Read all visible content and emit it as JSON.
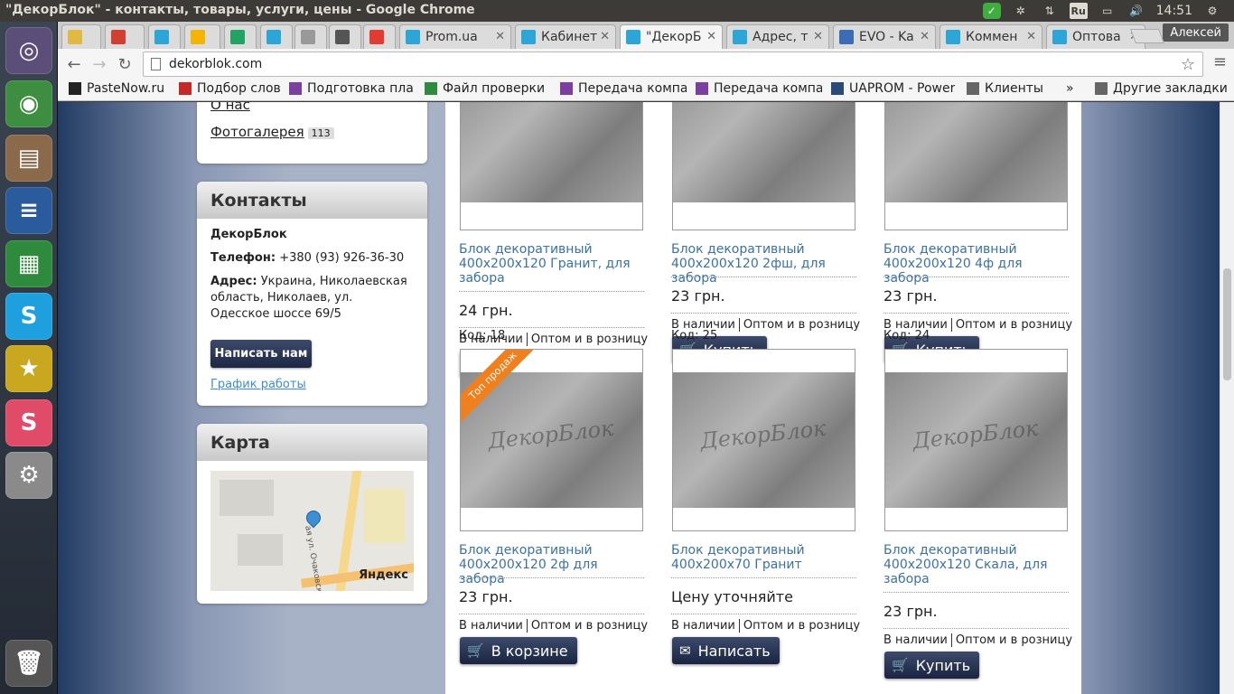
{
  "window": {
    "title": "\"ДекорБлок\" - контакты, товары, услуги, цены - Google Chrome"
  },
  "tray": {
    "lang": "Ru",
    "time": "14:51"
  },
  "launcher": [
    {
      "name": "ubuntu-dash",
      "glyph": "◎",
      "color": "#5b4f7a"
    },
    {
      "name": "chrome",
      "glyph": "◉",
      "color": "#3e8e41"
    },
    {
      "name": "files",
      "glyph": "▤",
      "color": "#8a6a4a"
    },
    {
      "name": "writer",
      "glyph": "≡",
      "color": "#2a5b9c"
    },
    {
      "name": "calc",
      "glyph": "▦",
      "color": "#2e8b3e"
    },
    {
      "name": "skype",
      "glyph": "S",
      "color": "#1ea0df"
    },
    {
      "name": "star-app",
      "glyph": "★",
      "color": "#c9a820"
    },
    {
      "name": "slack",
      "glyph": "S",
      "color": "#e04b67"
    },
    {
      "name": "settings",
      "glyph": "⚙",
      "color": "#8a8a8a"
    },
    {
      "name": "trash",
      "glyph": "🗑",
      "color": "#555"
    }
  ],
  "tabs": [
    {
      "label": "",
      "color": "#e0b940"
    },
    {
      "label": "",
      "color": "#d23f31"
    },
    {
      "label": "",
      "color": "#2aa6d8"
    },
    {
      "label": "",
      "color": "#f4b400"
    },
    {
      "label": "",
      "color": "#1fa463"
    },
    {
      "label": "",
      "color": "#2aa6d8"
    },
    {
      "label": "",
      "color": "#999"
    },
    {
      "label": "",
      "color": "#555"
    },
    {
      "label": "",
      "color": "#e33b2e"
    },
    {
      "label": "Prom.ua",
      "color": "#2aa6d8"
    },
    {
      "label": "Кабинет",
      "color": "#2aa6d8"
    },
    {
      "label": "\"ДекорБ",
      "color": "#2aa6d8"
    },
    {
      "label": "Адрес, т",
      "color": "#2aa6d8"
    },
    {
      "label": "EVO - Ka",
      "color": "#3a6db5"
    },
    {
      "label": "Коммен",
      "color": "#2aa6d8"
    },
    {
      "label": "Оптова",
      "color": "#2aa6d8"
    }
  ],
  "user": "Алексей",
  "url": "dekorblok.com",
  "bookmarks": [
    {
      "label": "PasteNow.ru",
      "color": "#222"
    },
    {
      "label": "Подбор слов",
      "color": "#c62828"
    },
    {
      "label": "Подготовка пла",
      "color": "#7b3fa0"
    },
    {
      "label": "Файл проверки",
      "color": "#2e8b3e"
    },
    {
      "label": "Передача компа",
      "color": "#7b3fa0"
    },
    {
      "label": "Передача компа",
      "color": "#7b3fa0"
    },
    {
      "label": "UAPROM - Power",
      "color": "#2b4a78"
    },
    {
      "label": "Клиенты",
      "color": "#666"
    }
  ],
  "bookmarks_more": "»",
  "bookmarks_other": "Другие закладки",
  "sidebar": {
    "about": "О нас",
    "gallery": "Фотогалерея",
    "gallery_count": "113",
    "contacts": {
      "title": "Контакты",
      "company": "ДекорБлок",
      "phone_label": "Телефон:",
      "phone": "+380 (93) 926-36-30",
      "address_label": "Адрес:",
      "address": "Украина, Николаевская область, Николаев, ул. Одесское шоссе 69/5",
      "write_btn": "Написать нам",
      "schedule": "График работы"
    },
    "map": {
      "title": "Карта",
      "street": "ая ул. Очаковская ул",
      "brand": "Яндекс"
    }
  },
  "products": [
    {
      "code": "",
      "name": "Блок декоративный 400х200х120 Гранит, для забора",
      "price": "24 грн.",
      "stock": "В наличии",
      "trade": "Оптом и в розницу",
      "btn": "Купить",
      "btn_icon": "cart",
      "ribbon": ""
    },
    {
      "code": "",
      "name": "Блок декоративный 400х200х120 2фш, для забора",
      "price": "23 грн.",
      "stock": "В наличии",
      "trade": "Оптом и в розницу",
      "btn": "Купить",
      "btn_icon": "cart",
      "ribbon": ""
    },
    {
      "code": "",
      "name": "Блок декоративный 400х200х120 4ф для забора",
      "price": "23 грн.",
      "stock": "В наличии",
      "trade": "Оптом и в розницу",
      "btn": "Купить",
      "btn_icon": "cart",
      "ribbon": ""
    },
    {
      "code": "Код: 18",
      "name": "Блок декоративный 400х200х120 2ф для забора",
      "price": "23 грн.",
      "stock": "В наличии",
      "trade": "Оптом и в розницу",
      "btn": "В корзине",
      "btn_icon": "cart",
      "ribbon": "Топ продаж"
    },
    {
      "code": "Код: 25",
      "name": "Блок декоративный 400х200х70 Гранит",
      "price": "Цену уточняйте",
      "stock": "В наличии",
      "trade": "Оптом и в розницу",
      "btn": "Написать",
      "btn_icon": "mail",
      "ribbon": ""
    },
    {
      "code": "Код: 24",
      "name": "Блок декоративный 400х200х120 Скала, для забора",
      "price": "23 грн.",
      "stock": "В наличии",
      "trade": "Оптом и в розницу",
      "btn": "Купить",
      "btn_icon": "cart",
      "ribbon": ""
    }
  ],
  "watermark": "ДекорБлок"
}
